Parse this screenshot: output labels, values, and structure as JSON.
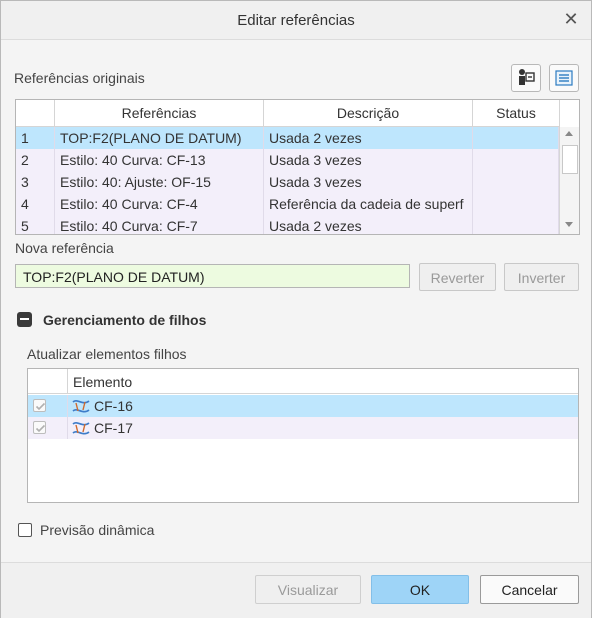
{
  "window": {
    "title": "Editar referências"
  },
  "original_refs": {
    "section_label": "Referências originais",
    "columns": [
      "",
      "Referências",
      "Descrição",
      "Status"
    ],
    "rows": [
      {
        "num": "1",
        "ref": "TOP:F2(PLANO DE DATUM)",
        "desc": "Usada 2 vezes",
        "status": ""
      },
      {
        "num": "2",
        "ref": "Estilo: 40  Curva: CF-13",
        "desc": "Usada 3 vezes",
        "status": ""
      },
      {
        "num": "3",
        "ref": "Estilo: 40: Ajuste: OF-15",
        "desc": "Usada 3 vezes",
        "status": ""
      },
      {
        "num": "4",
        "ref": "Estilo: 40  Curva: CF-4",
        "desc": "Referência da cadeia de superf",
        "status": ""
      },
      {
        "num": "5",
        "ref": "Estilo: 40  Curva: CF-7",
        "desc": "Usada 2 vezes",
        "status": ""
      }
    ],
    "selected_row": 0
  },
  "new_ref": {
    "label": "Nova referência",
    "value": "TOP:F2(PLANO DE DATUM)",
    "revert_label": "Reverter",
    "invert_label": "Inverter"
  },
  "children": {
    "section_label": "Gerenciamento de filhos",
    "update_label": "Atualizar elementos filhos",
    "column": "Elemento",
    "rows": [
      {
        "name": "CF-16",
        "checked": true
      },
      {
        "name": "CF-17",
        "checked": true
      }
    ]
  },
  "preview": {
    "label": "Previsão dinâmica",
    "checked": false
  },
  "footer": {
    "visualize_label": "Visualizar",
    "ok_label": "OK",
    "cancel_label": "Cancelar"
  },
  "colors": {
    "selected_row": "#bee6fd",
    "alt_row": "#f3effa",
    "input_bg": "#edfbe0",
    "ok_button": "#9ed4f7"
  }
}
